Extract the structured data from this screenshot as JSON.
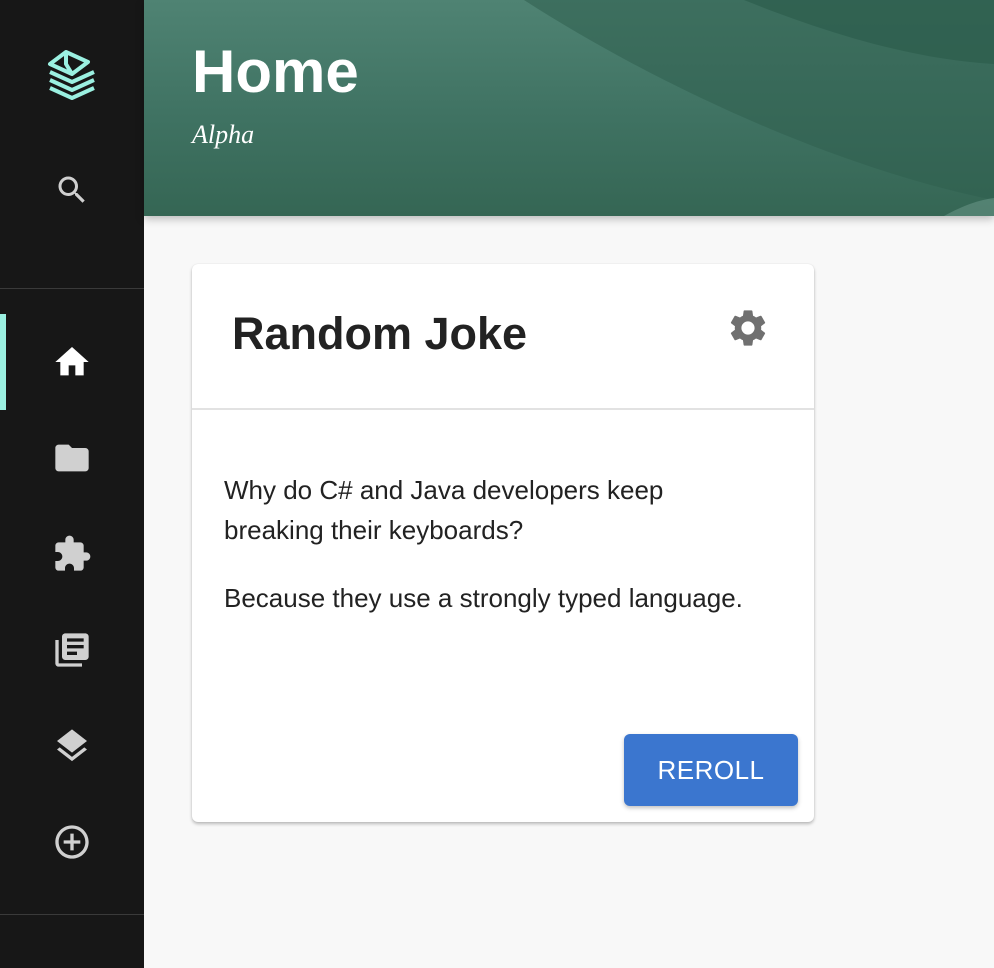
{
  "header": {
    "title": "Home",
    "subtitle": "Alpha"
  },
  "sidebar": {
    "logo": "backstage-logo-icon",
    "items": [
      {
        "icon": "search-icon",
        "active": false
      },
      {
        "icon": "home-icon",
        "active": true
      },
      {
        "icon": "folder-icon",
        "active": false
      },
      {
        "icon": "puzzle-icon",
        "active": false
      },
      {
        "icon": "library-books-icon",
        "active": false
      },
      {
        "icon": "layers-icon",
        "active": false
      },
      {
        "icon": "add-circle-icon",
        "active": false
      }
    ]
  },
  "card": {
    "title": "Random Joke",
    "settings_icon": "gear-icon",
    "setup": "Why do C# and Java developers keep breaking their keyboards?",
    "punchline": "Because they use a strongly typed language.",
    "reroll_label": "REROLL"
  },
  "colors": {
    "sidebar_bg": "#171717",
    "accent": "#9bf0e1",
    "header_bg": "#3f7262",
    "button_bg": "#3b76cf",
    "page_bg": "#f8f8f8"
  }
}
